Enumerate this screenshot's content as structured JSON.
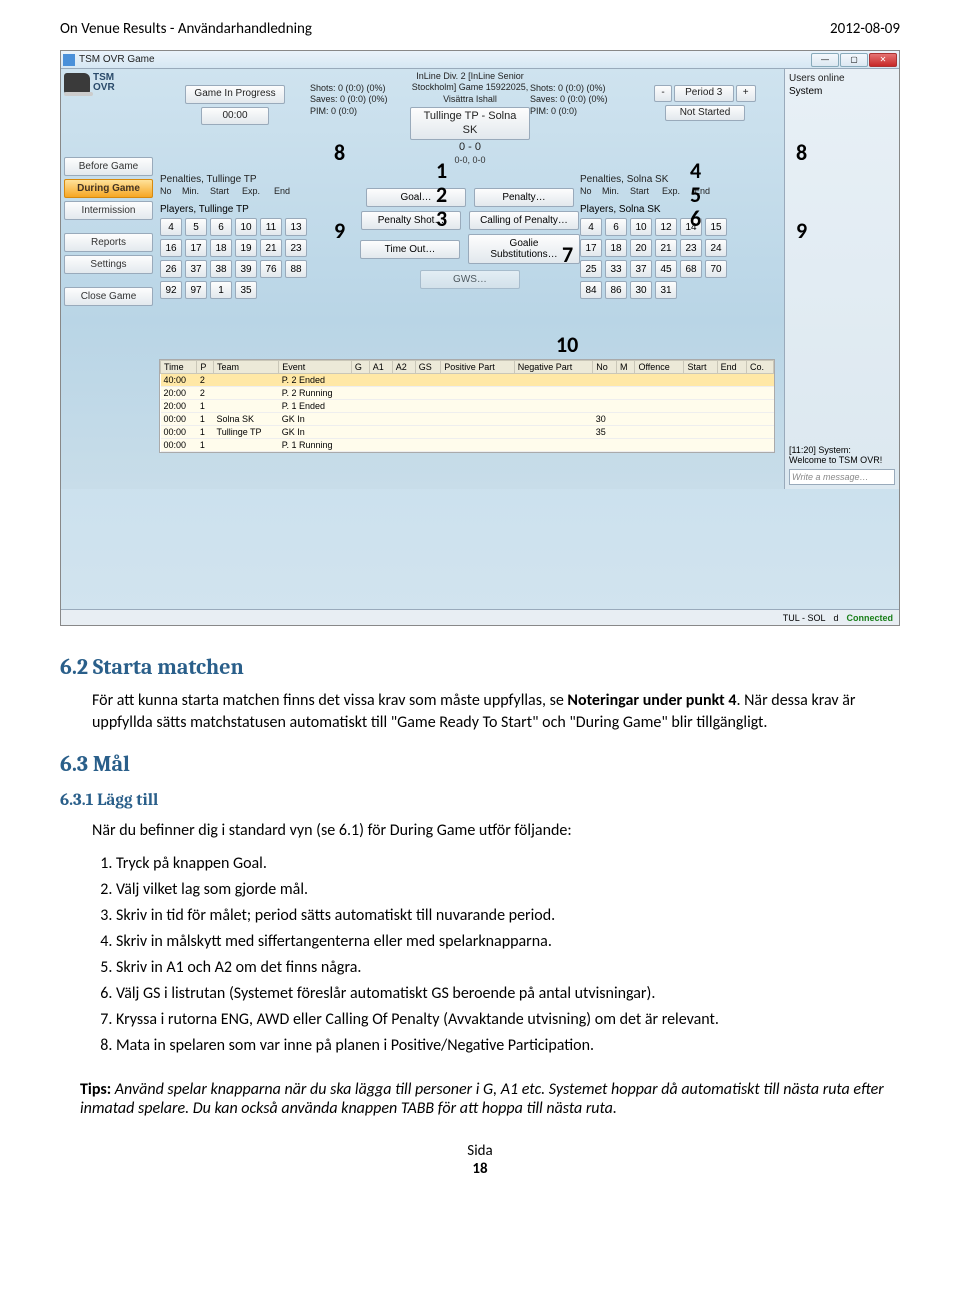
{
  "doc": {
    "header_left": "On Venue Results - Användarhandledning",
    "header_right": "2012-08-09",
    "footer_label": "Sida",
    "footer_page": "18"
  },
  "app": {
    "window_title": "TSM OVR Game",
    "brand_line1": "TSM",
    "brand_line2": "OVR",
    "nav": {
      "before": "Before Game",
      "during": "During Game",
      "intermission": "Intermission",
      "reports": "Reports",
      "settings": "Settings",
      "close": "Close Game"
    },
    "top": {
      "league_line": "InLine Div. 2 [InLine Senior Stockholm] Game 15922025, Visättra Ishall",
      "status": "Game In Progress",
      "clock": "00:00",
      "shots_a": "Shots: 0 (0:0) (0%)",
      "saves_a": "Saves: 0 (0:0) (0%)",
      "pim_a": "PIM: 0 (0:0)",
      "matchup": "Tullinge TP  - Solna SK",
      "score": "0 - 0",
      "subscore": "0-0, 0-0",
      "shots_b": "Shots: 0 (0:0) (0%)",
      "saves_b": "Saves: 0 (0:0) (0%)",
      "pim_b": "PIM: 0 (0:0)",
      "period_prev": "-",
      "period_label": "Period 3",
      "period_next": "+",
      "not_started": "Not Started"
    },
    "penalties": {
      "left_title": "Penalties, Tullinge TP",
      "right_title": "Penalties, Solna SK",
      "cols": {
        "no": "No",
        "min": "Min.",
        "start": "Start",
        "exp": "Exp.",
        "end": "End"
      }
    },
    "actions": {
      "goal": "Goal…",
      "penalty": "Penalty…",
      "penalty_shot": "Penalty Shot…",
      "call_penalty": "Calling of Penalty…",
      "timeout": "Time Out…",
      "goalie_sub": "Goalie Substitutions…",
      "gws": "GWS…"
    },
    "players": {
      "left_title": "Players, Tullinge TP",
      "right_title": "Players, Solna SK",
      "left_nums": [
        "4",
        "5",
        "6",
        "10",
        "11",
        "13",
        "16",
        "17",
        "18",
        "19",
        "21",
        "23",
        "26",
        "37",
        "38",
        "39",
        "76",
        "88",
        "92",
        "97",
        "1",
        "35"
      ],
      "right_nums": [
        "4",
        "6",
        "10",
        "12",
        "14",
        "15",
        "17",
        "18",
        "20",
        "21",
        "23",
        "24",
        "25",
        "33",
        "37",
        "45",
        "68",
        "70",
        "84",
        "86",
        "30",
        "31"
      ]
    },
    "log": {
      "headers": [
        "Time",
        "P",
        "Team",
        "Event",
        "G",
        "A1",
        "A2",
        "GS",
        "Positive Part",
        "Negative Part",
        "No",
        "M",
        "Offence",
        "Start",
        "End",
        "Co."
      ],
      "rows": [
        {
          "time": "40:00",
          "p": "2",
          "team": "",
          "event": "P. 2 Ended",
          "no": ""
        },
        {
          "time": "20:00",
          "p": "2",
          "team": "",
          "event": "P. 2 Running",
          "no": ""
        },
        {
          "time": "20:00",
          "p": "1",
          "team": "",
          "event": "P. 1 Ended",
          "no": ""
        },
        {
          "time": "00:00",
          "p": "1",
          "team": "Solna SK",
          "event": "GK In",
          "no": "30"
        },
        {
          "time": "00:00",
          "p": "1",
          "team": "Tullinge TP",
          "event": "GK In",
          "no": "35"
        },
        {
          "time": "00:00",
          "p": "1",
          "team": "",
          "event": "P. 1 Running",
          "no": ""
        }
      ]
    },
    "right": {
      "users_online": "Users online",
      "system": "System",
      "sys_msg_time": "[11:20] System:",
      "sys_msg_body": "Welcome to TSM OVR!",
      "msg_placeholder": "Write a message…"
    },
    "status": {
      "left": "TUL - SOL",
      "mid": "d",
      "conn": "Connected"
    }
  },
  "annots": {
    "n1": "1",
    "n2": "2",
    "n3": "3",
    "n4": "4",
    "n5": "5",
    "n6": "6",
    "n7": "7",
    "n8l": "8",
    "n8r": "8",
    "n9l": "9",
    "n9r": "9",
    "n10": "10"
  },
  "text": {
    "h62": "6.2   Starta matchen",
    "p1a": "För att kunna starta matchen finns det vissa krav som måste uppfyllas, se ",
    "p1b": "Noteringar under punkt 4",
    "p1c": ". När dessa krav är uppfyllda sätts matchstatusen automatiskt till \"Game Ready To Start\" och \"During Game\" blir tillgängligt.",
    "h63": "6.3   Mål",
    "h631": "6.3.1   Lägg till",
    "p2": "När du befinner dig i standard vyn (se 6.1) för During Game utför följande:",
    "li1": "Tryck på knappen Goal.",
    "li2": "Välj vilket lag som gjorde mål.",
    "li3": "Skriv in tid för målet; period sätts automatiskt till nuvarande period.",
    "li4": "Skriv in målskytt med siffertangenterna eller med spelarknapparna.",
    "li5": "Skriv in A1 och A2 om det finns några.",
    "li6": "Välj GS i listrutan (Systemet föreslår automatiskt GS beroende på antal utvisningar).",
    "li7": "Kryssa i rutorna ENG, AWD eller Calling Of Penalty (Avvaktande utvisning) om det är relevant.",
    "li8": "Mata in spelaren som var inne på planen i Positive/Negative Participation.",
    "tips_label": "Tips: ",
    "tips_body": "Använd spelar knapparna när du ska lägga till personer i G, A1 etc. Systemet hoppar då automatiskt till nästa ruta efter inmatad spelare. Du kan också använda knappen TABB för att hoppa till nästa ruta."
  }
}
